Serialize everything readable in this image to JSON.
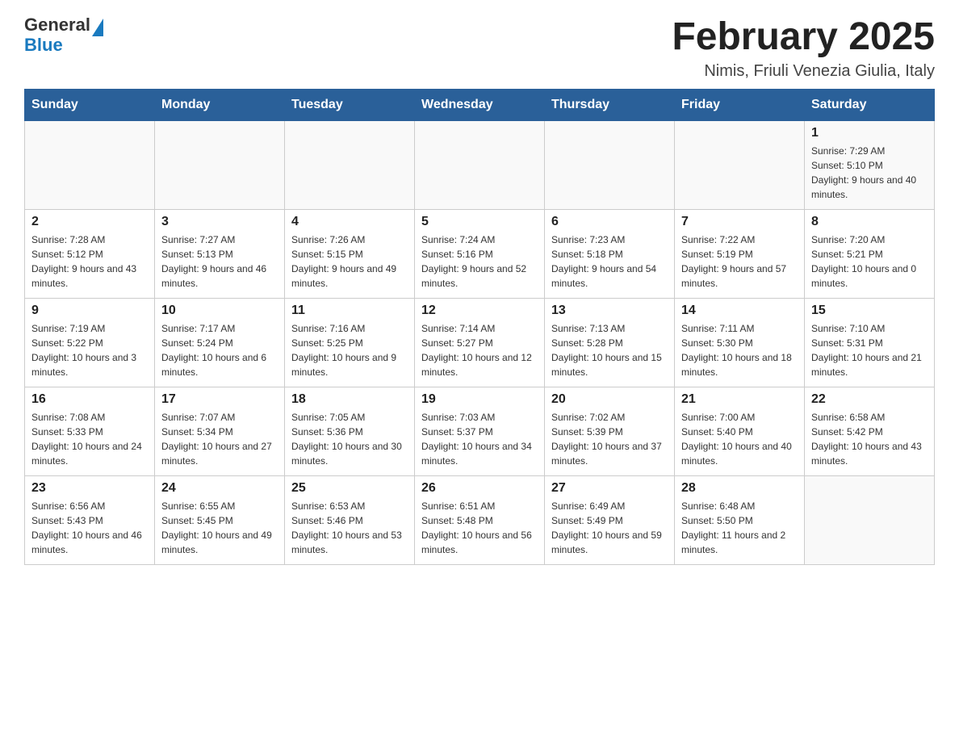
{
  "header": {
    "logo_general": "General",
    "logo_blue": "Blue",
    "title": "February 2025",
    "subtitle": "Nimis, Friuli Venezia Giulia, Italy"
  },
  "days_of_week": [
    "Sunday",
    "Monday",
    "Tuesday",
    "Wednesday",
    "Thursday",
    "Friday",
    "Saturday"
  ],
  "weeks": [
    [
      {
        "day": "",
        "info": ""
      },
      {
        "day": "",
        "info": ""
      },
      {
        "day": "",
        "info": ""
      },
      {
        "day": "",
        "info": ""
      },
      {
        "day": "",
        "info": ""
      },
      {
        "day": "",
        "info": ""
      },
      {
        "day": "1",
        "info": "Sunrise: 7:29 AM\nSunset: 5:10 PM\nDaylight: 9 hours and 40 minutes."
      }
    ],
    [
      {
        "day": "2",
        "info": "Sunrise: 7:28 AM\nSunset: 5:12 PM\nDaylight: 9 hours and 43 minutes."
      },
      {
        "day": "3",
        "info": "Sunrise: 7:27 AM\nSunset: 5:13 PM\nDaylight: 9 hours and 46 minutes."
      },
      {
        "day": "4",
        "info": "Sunrise: 7:26 AM\nSunset: 5:15 PM\nDaylight: 9 hours and 49 minutes."
      },
      {
        "day": "5",
        "info": "Sunrise: 7:24 AM\nSunset: 5:16 PM\nDaylight: 9 hours and 52 minutes."
      },
      {
        "day": "6",
        "info": "Sunrise: 7:23 AM\nSunset: 5:18 PM\nDaylight: 9 hours and 54 minutes."
      },
      {
        "day": "7",
        "info": "Sunrise: 7:22 AM\nSunset: 5:19 PM\nDaylight: 9 hours and 57 minutes."
      },
      {
        "day": "8",
        "info": "Sunrise: 7:20 AM\nSunset: 5:21 PM\nDaylight: 10 hours and 0 minutes."
      }
    ],
    [
      {
        "day": "9",
        "info": "Sunrise: 7:19 AM\nSunset: 5:22 PM\nDaylight: 10 hours and 3 minutes."
      },
      {
        "day": "10",
        "info": "Sunrise: 7:17 AM\nSunset: 5:24 PM\nDaylight: 10 hours and 6 minutes."
      },
      {
        "day": "11",
        "info": "Sunrise: 7:16 AM\nSunset: 5:25 PM\nDaylight: 10 hours and 9 minutes."
      },
      {
        "day": "12",
        "info": "Sunrise: 7:14 AM\nSunset: 5:27 PM\nDaylight: 10 hours and 12 minutes."
      },
      {
        "day": "13",
        "info": "Sunrise: 7:13 AM\nSunset: 5:28 PM\nDaylight: 10 hours and 15 minutes."
      },
      {
        "day": "14",
        "info": "Sunrise: 7:11 AM\nSunset: 5:30 PM\nDaylight: 10 hours and 18 minutes."
      },
      {
        "day": "15",
        "info": "Sunrise: 7:10 AM\nSunset: 5:31 PM\nDaylight: 10 hours and 21 minutes."
      }
    ],
    [
      {
        "day": "16",
        "info": "Sunrise: 7:08 AM\nSunset: 5:33 PM\nDaylight: 10 hours and 24 minutes."
      },
      {
        "day": "17",
        "info": "Sunrise: 7:07 AM\nSunset: 5:34 PM\nDaylight: 10 hours and 27 minutes."
      },
      {
        "day": "18",
        "info": "Sunrise: 7:05 AM\nSunset: 5:36 PM\nDaylight: 10 hours and 30 minutes."
      },
      {
        "day": "19",
        "info": "Sunrise: 7:03 AM\nSunset: 5:37 PM\nDaylight: 10 hours and 34 minutes."
      },
      {
        "day": "20",
        "info": "Sunrise: 7:02 AM\nSunset: 5:39 PM\nDaylight: 10 hours and 37 minutes."
      },
      {
        "day": "21",
        "info": "Sunrise: 7:00 AM\nSunset: 5:40 PM\nDaylight: 10 hours and 40 minutes."
      },
      {
        "day": "22",
        "info": "Sunrise: 6:58 AM\nSunset: 5:42 PM\nDaylight: 10 hours and 43 minutes."
      }
    ],
    [
      {
        "day": "23",
        "info": "Sunrise: 6:56 AM\nSunset: 5:43 PM\nDaylight: 10 hours and 46 minutes."
      },
      {
        "day": "24",
        "info": "Sunrise: 6:55 AM\nSunset: 5:45 PM\nDaylight: 10 hours and 49 minutes."
      },
      {
        "day": "25",
        "info": "Sunrise: 6:53 AM\nSunset: 5:46 PM\nDaylight: 10 hours and 53 minutes."
      },
      {
        "day": "26",
        "info": "Sunrise: 6:51 AM\nSunset: 5:48 PM\nDaylight: 10 hours and 56 minutes."
      },
      {
        "day": "27",
        "info": "Sunrise: 6:49 AM\nSunset: 5:49 PM\nDaylight: 10 hours and 59 minutes."
      },
      {
        "day": "28",
        "info": "Sunrise: 6:48 AM\nSunset: 5:50 PM\nDaylight: 11 hours and 2 minutes."
      },
      {
        "day": "",
        "info": ""
      }
    ]
  ]
}
